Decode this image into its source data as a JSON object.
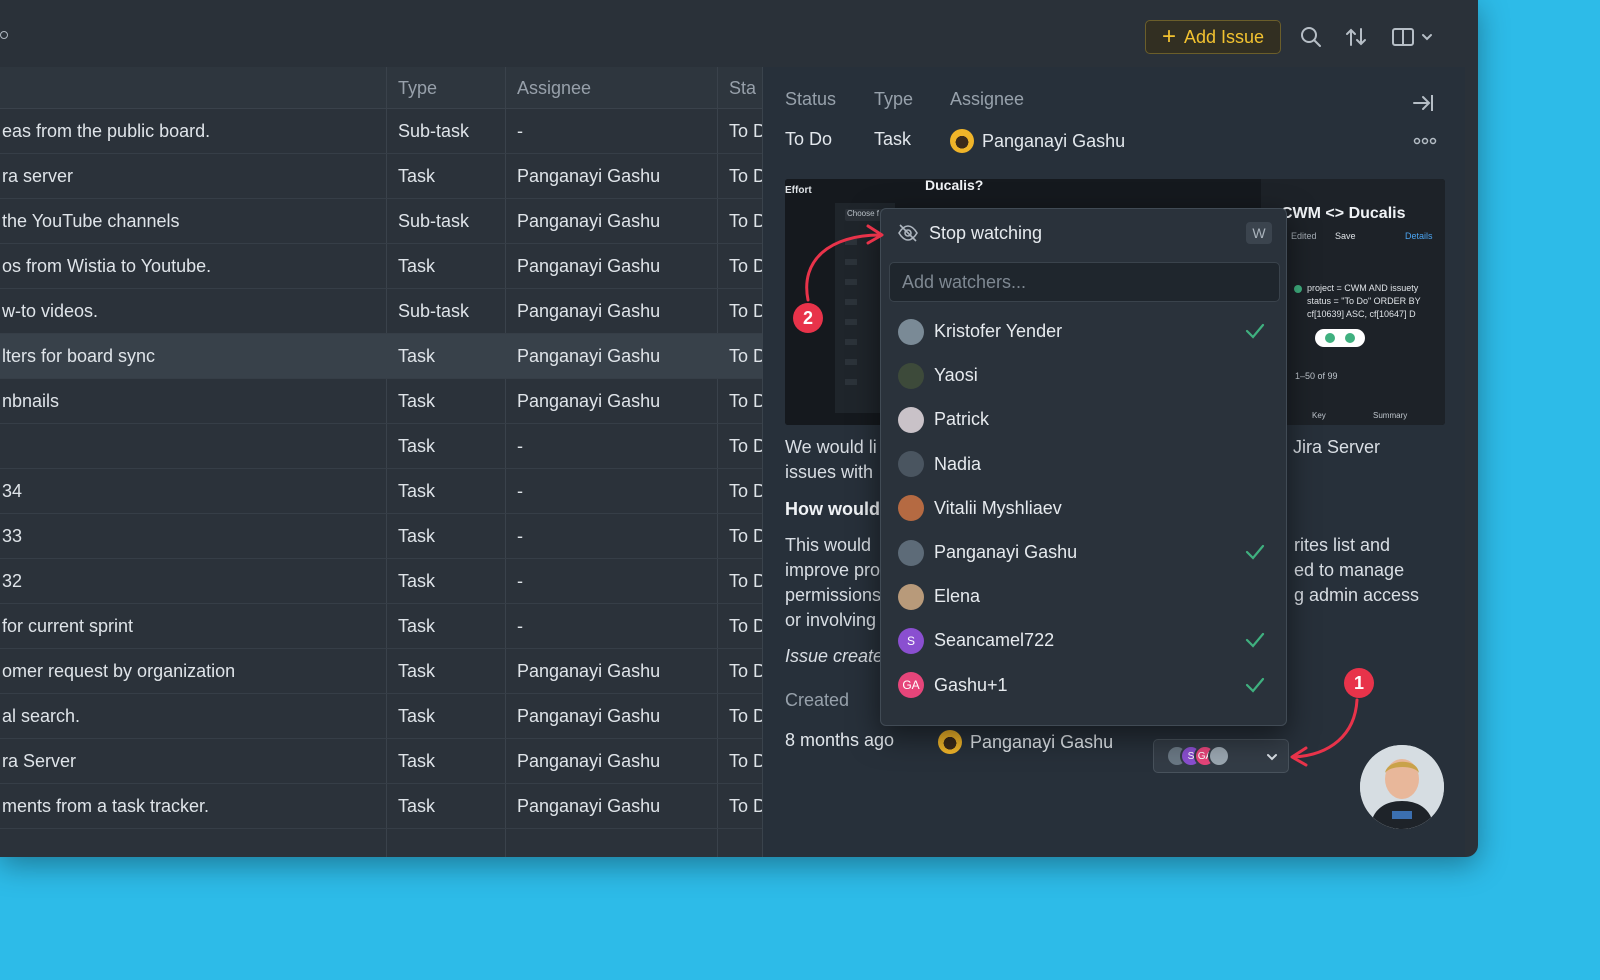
{
  "toolbar": {
    "add_issue_label": "Add Issue",
    "accent_color": "#f2c230"
  },
  "table": {
    "headers": {
      "summary": "",
      "type": "Type",
      "assignee": "Assignee",
      "status": "Sta"
    },
    "rows": [
      {
        "summary": "eas from the public board.",
        "type": "Sub-task",
        "assignee": "-",
        "status": "To D"
      },
      {
        "summary": "ra server",
        "type": "Task",
        "assignee": "Panganayi Gashu",
        "status": "To D"
      },
      {
        "summary": " the YouTube channels",
        "type": "Sub-task",
        "assignee": "Panganayi Gashu",
        "status": "To D"
      },
      {
        "summary": "os from Wistia to Youtube.",
        "type": "Task",
        "assignee": "Panganayi Gashu",
        "status": "To D"
      },
      {
        "summary": "w-to videos.",
        "type": "Sub-task",
        "assignee": "Panganayi Gashu",
        "status": "To D"
      },
      {
        "summary": "lters for board sync",
        "type": "Task",
        "assignee": "Panganayi Gashu",
        "status": "To D"
      },
      {
        "summary": "nbnails",
        "type": "Task",
        "assignee": "Panganayi Gashu",
        "status": "To D"
      },
      {
        "summary": "",
        "type": "Task",
        "assignee": "-",
        "status": "To D"
      },
      {
        "summary": " 34",
        "type": "Task",
        "assignee": "-",
        "status": "To D"
      },
      {
        "summary": " 33",
        "type": "Task",
        "assignee": "-",
        "status": "To D"
      },
      {
        "summary": " 32",
        "type": "Task",
        "assignee": "-",
        "status": "To D"
      },
      {
        "summary": " for current sprint",
        "type": "Task",
        "assignee": "-",
        "status": "To D"
      },
      {
        "summary": "omer request by organization",
        "type": "Task",
        "assignee": "Panganayi Gashu",
        "status": "To D"
      },
      {
        "summary": "al search.",
        "type": "Task",
        "assignee": "Panganayi Gashu",
        "status": "To D"
      },
      {
        "summary": "ra Server",
        "type": "Task",
        "assignee": "Panganayi Gashu",
        "status": "To D"
      },
      {
        "summary": "ments from a task tracker.",
        "type": "Task",
        "assignee": "Panganayi Gashu",
        "status": "To D"
      }
    ]
  },
  "detail": {
    "labels": {
      "status": "Status",
      "type": "Type",
      "assignee": "Assignee",
      "created": "Created"
    },
    "status": "To Do",
    "type": "Task",
    "assignee": "Panganayi Gashu",
    "created_value": "8 months ago",
    "creator": "Panganayi Gashu",
    "image_texts": {
      "effort": "Effort",
      "ducalis_q": "Ducalis?",
      "choose": "Choose f",
      "cwm": "CWM <> Ducalis",
      "edited": "Edited",
      "save": "Save",
      "details": "Details",
      "jql1": "project = CWM AND issuety",
      "jql2": "status = \"To Do\" ORDER BY",
      "jql3": "cf[10639] ASC, cf[10647] D",
      "count": "1–50 of 99",
      "key": "Key",
      "summary": "Summary"
    },
    "desc_line1_a": "We would li",
    "desc_line1_b": "Jira Server",
    "desc_line2": "issues with",
    "heading": "How would",
    "p_line1_a": "This would",
    "p_line1_b": "rites list and",
    "p_line2_a": "improve pro",
    "p_line2_b": "ed to manage",
    "p_line3_a": "permissions",
    "p_line3_b": "g admin access",
    "p_line4": "or involving",
    "italic_line": "Issue create"
  },
  "watchers_dropdown": {
    "stop_watching_label": "Stop watching",
    "shortcut": "W",
    "input_placeholder": "Add watchers...",
    "users": [
      {
        "name": "Kristofer Yender",
        "checked": true,
        "avatar_color": "#7a8a96",
        "initials": ""
      },
      {
        "name": "Yaosi",
        "checked": false,
        "avatar_color": "#3d4a3a",
        "initials": ""
      },
      {
        "name": "Patrick",
        "checked": false,
        "avatar_color": "#c9c2c8",
        "initials": ""
      },
      {
        "name": "Nadia",
        "checked": false,
        "avatar_color": "#4a5560",
        "initials": ""
      },
      {
        "name": "Vitalii Myshliaev",
        "checked": false,
        "avatar_color": "#b56a42",
        "initials": ""
      },
      {
        "name": "Panganayi Gashu",
        "checked": true,
        "avatar_color": "#5d6b78",
        "initials": ""
      },
      {
        "name": "Elena",
        "checked": false,
        "avatar_color": "#b89a7a",
        "initials": ""
      },
      {
        "name": "Seancamel722",
        "checked": true,
        "avatar_color": "#8a4fd0",
        "initials": "S"
      },
      {
        "name": "Gashu+1",
        "checked": true,
        "avatar_color": "#e6457a",
        "initials": "GA"
      }
    ],
    "check_color": "#3fb07f"
  },
  "watchers_button": {
    "avatars": [
      {
        "color": "#6a7884",
        "initials": ""
      },
      {
        "color": "#8a4fd0",
        "initials": "S"
      },
      {
        "color": "#e6457a",
        "initials": "GA"
      },
      {
        "color": "#9aa6b0",
        "initials": ""
      }
    ]
  },
  "annotations": {
    "badge_1": "1",
    "badge_2": "2",
    "color": "#e8334a"
  }
}
